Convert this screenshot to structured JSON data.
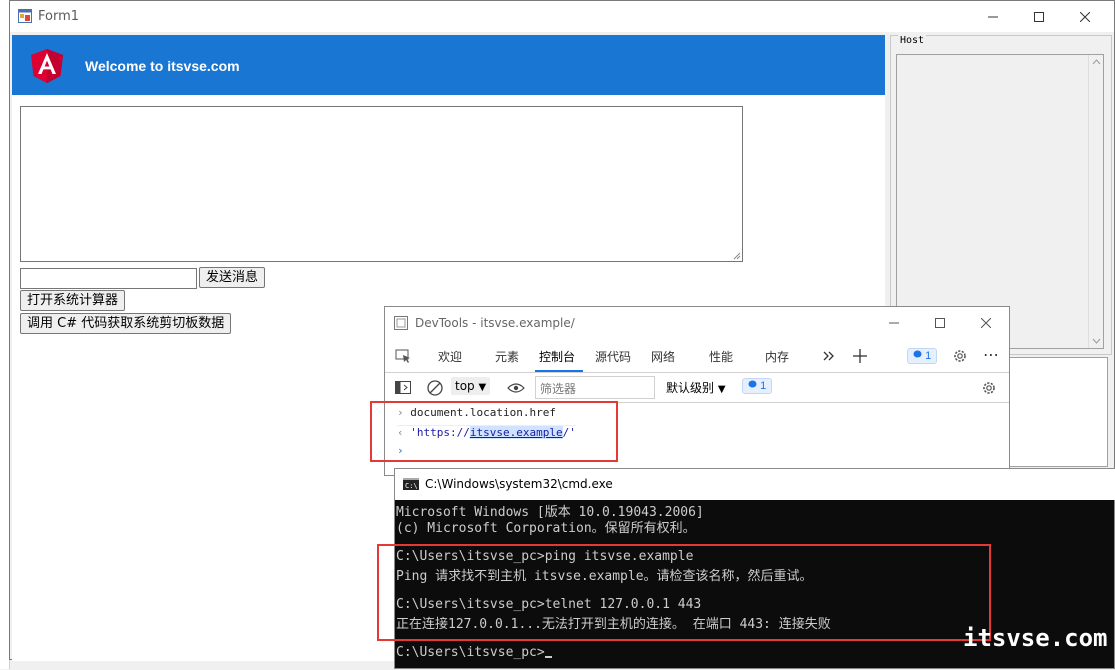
{
  "form1": {
    "title": "Form1",
    "banner_text": "Welcome to itsvse.com",
    "send_button": "发送消息",
    "calc_button": "打开系统计算器",
    "clipboard_button": "调用 C# 代码获取系统剪切板数据",
    "host_label": "Host"
  },
  "devtools": {
    "title": "DevTools - itsvse.example/",
    "tabs": [
      "欢迎",
      "元素",
      "控制台",
      "源代码",
      "网络",
      "性能",
      "内存"
    ],
    "active_tab": "控制台",
    "context": "top",
    "filter_placeholder": "筛选器",
    "level": "默认级别",
    "issues_count": "1",
    "console": {
      "input": "document.location.href",
      "output_prefix": "'https://",
      "output_host": "itsvse.example",
      "output_suffix": "/'"
    }
  },
  "cmd": {
    "title": "C:\\Windows\\system32\\cmd.exe",
    "lines": [
      "Microsoft Windows [版本 10.0.19043.2006]",
      "(c) Microsoft Corporation。保留所有权利。",
      "",
      "C:\\Users\\itsvse_pc>ping itsvse.example",
      "Ping 请求找不到主机 itsvse.example。请检查该名称，然后重试。",
      "",
      "C:\\Users\\itsvse_pc>telnet 127.0.0.1 443",
      "正在连接127.0.0.1...无法打开到主机的连接。 在端口 443: 连接失败",
      "",
      "C:\\Users\\itsvse_pc>"
    ]
  },
  "watermark": "itsvse.com",
  "colors": {
    "banner": "#1976d2",
    "highlight_box": "#e53935",
    "cmd_bg": "#0c0c0c"
  }
}
